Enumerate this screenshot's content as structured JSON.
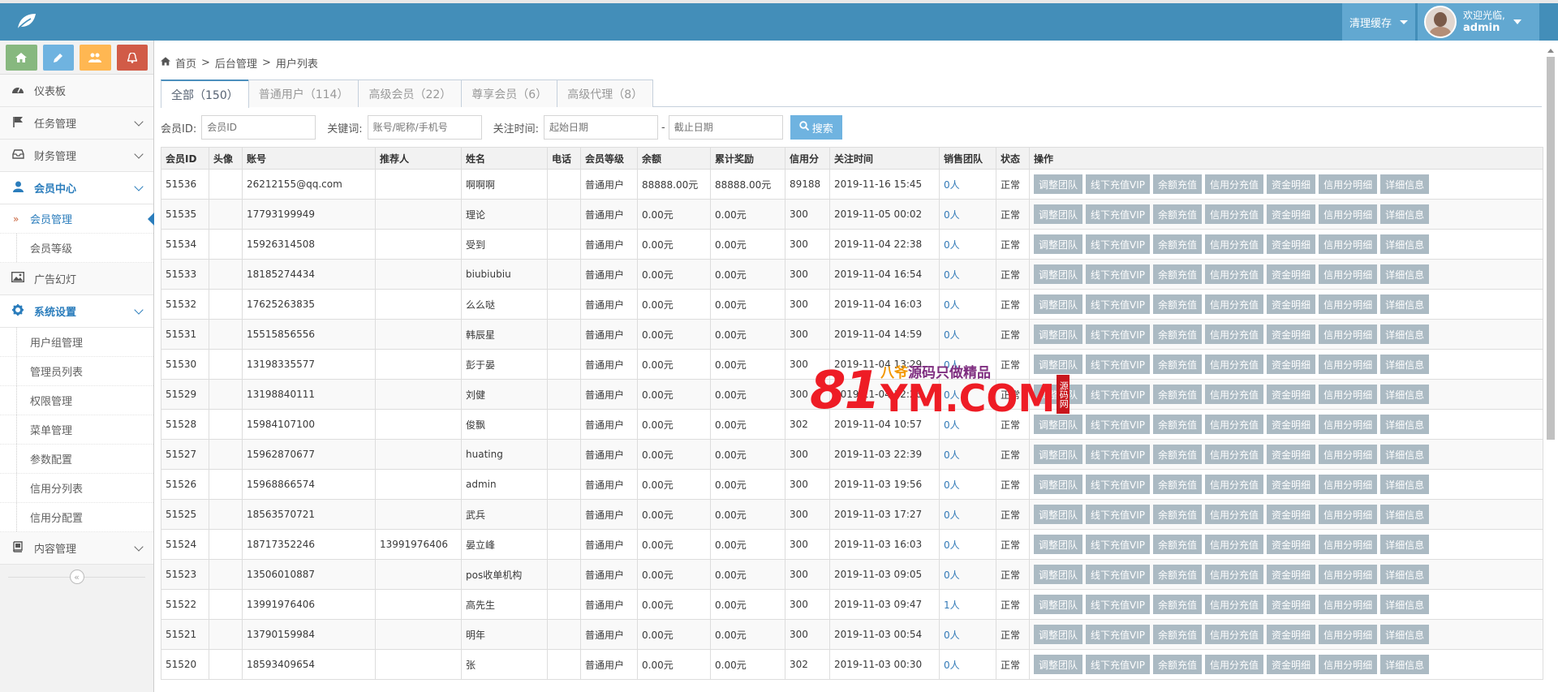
{
  "header": {
    "clear_cache": "清理缓存",
    "welcome": "欢迎光临,",
    "username": "admin"
  },
  "sidebar": {
    "shortcut_icons": [
      "home-icon",
      "pencil-icon",
      "users-icon",
      "bell-icon"
    ],
    "items": [
      {
        "label": "仪表板"
      },
      {
        "label": "任务管理"
      },
      {
        "label": "财务管理"
      },
      {
        "label": "会员中心"
      },
      {
        "label": "会员管理"
      },
      {
        "label": "会员等级"
      },
      {
        "label": "广告幻灯"
      },
      {
        "label": "系统设置"
      },
      {
        "label": "用户组管理"
      },
      {
        "label": "管理员列表"
      },
      {
        "label": "权限管理"
      },
      {
        "label": "菜单管理"
      },
      {
        "label": "参数配置"
      },
      {
        "label": "信用分列表"
      },
      {
        "label": "信用分配置"
      },
      {
        "label": "内容管理"
      }
    ]
  },
  "breadcrumb": [
    "首页",
    "后台管理",
    "用户列表"
  ],
  "tabs": [
    {
      "label": "全部（150）"
    },
    {
      "label": "普通用户（114）"
    },
    {
      "label": "高级会员（22）"
    },
    {
      "label": "尊享会员（6）"
    },
    {
      "label": "高级代理（8）"
    }
  ],
  "filter": {
    "member_id_label": "会员ID:",
    "member_id_placeholder": "会员ID",
    "keyword_label": "关键词:",
    "keyword_placeholder": "账号/昵称/手机号",
    "time_label": "关注时间:",
    "start_placeholder": "起始日期",
    "dash": "-",
    "end_placeholder": "截止日期",
    "search_button": "搜索"
  },
  "table": {
    "columns": [
      "会员ID",
      "头像",
      "账号",
      "推荐人",
      "姓名",
      "电话",
      "会员等级",
      "余额",
      "累计奖励",
      "信用分",
      "关注时间",
      "销售团队",
      "状态",
      "操作"
    ],
    "actions": [
      "调整团队",
      "线下充值VIP",
      "余额充值",
      "信用分充值",
      "资金明细",
      "信用分明细",
      "详细信息"
    ],
    "rows": [
      {
        "id": "51536",
        "account": "26212155@qq.com",
        "referrer": "",
        "name": "啊啊啊",
        "level": "普通用户",
        "balance": "88888.00元",
        "reward": "88888.00元",
        "credit": "89188",
        "time": "2019-11-16 15:45",
        "team": "0人",
        "status": "正常"
      },
      {
        "id": "51535",
        "account": "17793199949",
        "referrer": "",
        "name": "理论",
        "level": "普通用户",
        "balance": "0.00元",
        "reward": "0.00元",
        "credit": "300",
        "time": "2019-11-05 00:02",
        "team": "0人",
        "status": "正常"
      },
      {
        "id": "51534",
        "account": "15926314508",
        "referrer": "",
        "name": "受到",
        "level": "普通用户",
        "balance": "0.00元",
        "reward": "0.00元",
        "credit": "300",
        "time": "2019-11-04 22:38",
        "team": "0人",
        "status": "正常"
      },
      {
        "id": "51533",
        "account": "18185274434",
        "referrer": "",
        "name": "biubiubiu",
        "level": "普通用户",
        "balance": "0.00元",
        "reward": "0.00元",
        "credit": "300",
        "time": "2019-11-04 16:54",
        "team": "0人",
        "status": "正常"
      },
      {
        "id": "51532",
        "account": "17625263835",
        "referrer": "",
        "name": "么么哒",
        "level": "普通用户",
        "balance": "0.00元",
        "reward": "0.00元",
        "credit": "300",
        "time": "2019-11-04 16:03",
        "team": "0人",
        "status": "正常"
      },
      {
        "id": "51531",
        "account": "15515856556",
        "referrer": "",
        "name": "韩辰星",
        "level": "普通用户",
        "balance": "0.00元",
        "reward": "0.00元",
        "credit": "300",
        "time": "2019-11-04 14:59",
        "team": "0人",
        "status": "正常"
      },
      {
        "id": "51530",
        "account": "13198335577",
        "referrer": "",
        "name": "彭于晏",
        "level": "普通用户",
        "balance": "0.00元",
        "reward": "0.00元",
        "credit": "300",
        "time": "2019-11-04 13:29",
        "team": "0人",
        "status": "正常"
      },
      {
        "id": "51529",
        "account": "13198840111",
        "referrer": "",
        "name": "刘健",
        "level": "普通用户",
        "balance": "0.00元",
        "reward": "0.00元",
        "credit": "300",
        "time": "2019-11-04 12:26",
        "team": "0人",
        "status": "正常"
      },
      {
        "id": "51528",
        "account": "15984107100",
        "referrer": "",
        "name": "俊飘",
        "level": "普通用户",
        "balance": "0.00元",
        "reward": "0.00元",
        "credit": "302",
        "time": "2019-11-04 10:57",
        "team": "0人",
        "status": "正常"
      },
      {
        "id": "51527",
        "account": "15962870677",
        "referrer": "",
        "name": "huating",
        "level": "普通用户",
        "balance": "0.00元",
        "reward": "0.00元",
        "credit": "300",
        "time": "2019-11-03 22:39",
        "team": "0人",
        "status": "正常"
      },
      {
        "id": "51526",
        "account": "15968866574",
        "referrer": "",
        "name": "admin",
        "level": "普通用户",
        "balance": "0.00元",
        "reward": "0.00元",
        "credit": "300",
        "time": "2019-11-03 19:56",
        "team": "0人",
        "status": "正常"
      },
      {
        "id": "51525",
        "account": "18563570721",
        "referrer": "",
        "name": "武兵",
        "level": "普通用户",
        "balance": "0.00元",
        "reward": "0.00元",
        "credit": "300",
        "time": "2019-11-03 17:27",
        "team": "0人",
        "status": "正常"
      },
      {
        "id": "51524",
        "account": "18717352246",
        "referrer": "13991976406",
        "name": "晏立峰",
        "level": "普通用户",
        "balance": "0.00元",
        "reward": "0.00元",
        "credit": "300",
        "time": "2019-11-03 16:03",
        "team": "0人",
        "status": "正常"
      },
      {
        "id": "51523",
        "account": "13506010887",
        "referrer": "",
        "name": "pos收单机构",
        "level": "普通用户",
        "balance": "0.00元",
        "reward": "0.00元",
        "credit": "300",
        "time": "2019-11-03 09:05",
        "team": "0人",
        "status": "正常"
      },
      {
        "id": "51522",
        "account": "13991976406",
        "referrer": "",
        "name": "高先生",
        "level": "普通用户",
        "balance": "0.00元",
        "reward": "0.00元",
        "credit": "300",
        "time": "2019-11-03 09:47",
        "team": "1人",
        "status": "正常"
      },
      {
        "id": "51521",
        "account": "13790159984",
        "referrer": "",
        "name": "明年",
        "level": "普通用户",
        "balance": "0.00元",
        "reward": "0.00元",
        "credit": "300",
        "time": "2019-11-03 00:54",
        "team": "0人",
        "status": "正常"
      },
      {
        "id": "51520",
        "account": "18593409654",
        "referrer": "",
        "name": "张",
        "level": "普通用户",
        "balance": "0.00元",
        "reward": "0.00元",
        "credit": "302",
        "time": "2019-11-03 00:30",
        "team": "0人",
        "status": "正常"
      }
    ]
  },
  "watermark": {
    "big": "81",
    "top_orange": "八爷",
    "top_purple": "源码只做精品",
    "com": "YM.COM",
    "stamp": "源码网"
  }
}
